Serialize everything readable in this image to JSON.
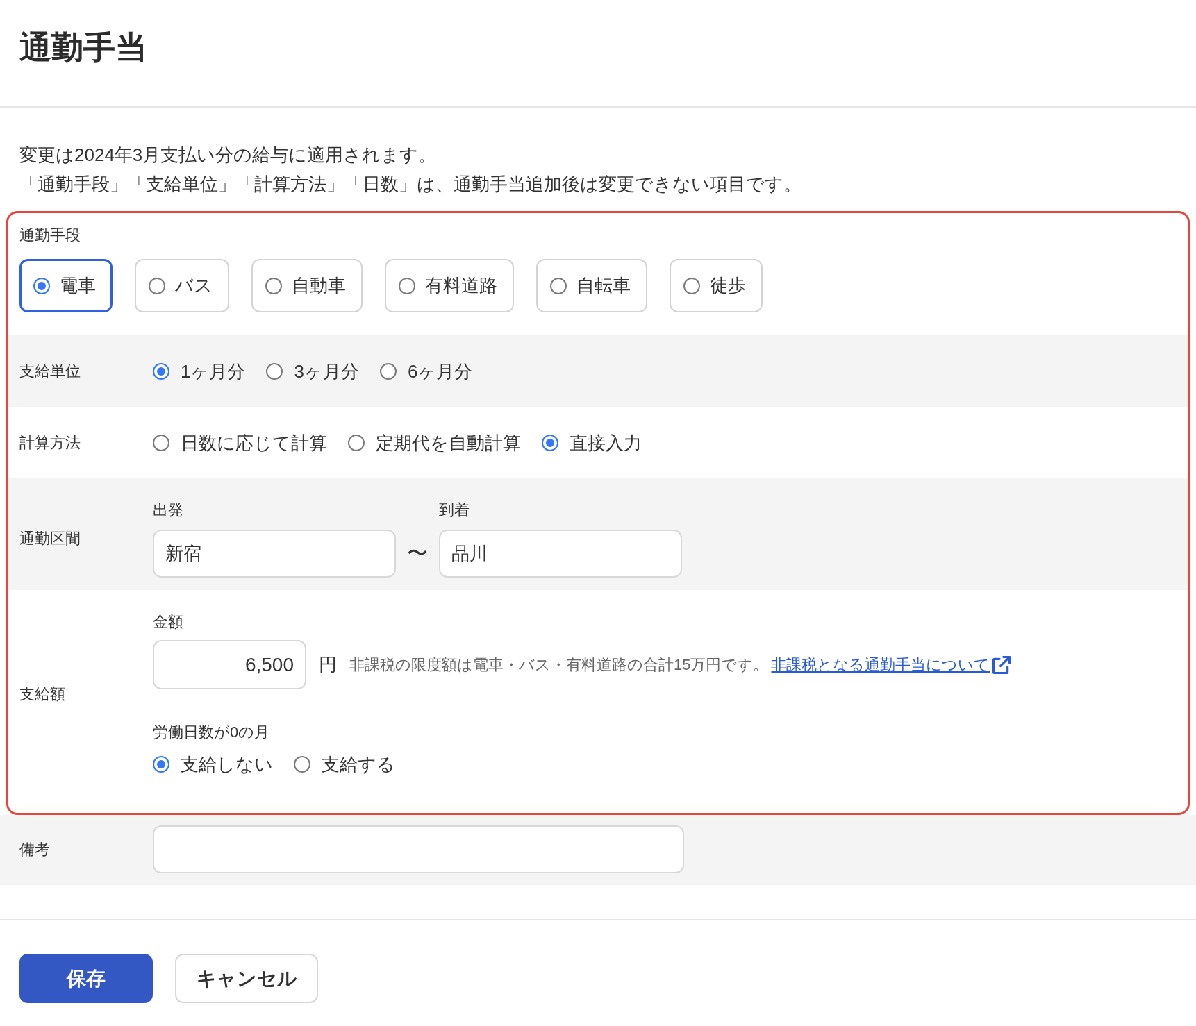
{
  "page": {
    "title": "通勤手当"
  },
  "notice": [
    "変更は2024年3月支払い分の給与に適用されます。",
    "「通勤手段」「支給単位」「計算方法」「日数」は、通勤手当追加後は変更できない項目です。"
  ],
  "highlighted_fields": [
    {
      "kind": "cards",
      "label": "通勤手段",
      "options": [
        {
          "label": "電車",
          "selected": true
        },
        {
          "label": "バス",
          "selected": false
        },
        {
          "label": "自動車",
          "selected": false
        },
        {
          "label": "有料道路",
          "selected": false
        },
        {
          "label": "自転車",
          "selected": false
        },
        {
          "label": "徒歩",
          "selected": false
        }
      ]
    },
    {
      "kind": "radios",
      "label": "支給単位",
      "options": [
        {
          "label": "1ヶ月分",
          "selected": true
        },
        {
          "label": "3ヶ月分",
          "selected": false
        },
        {
          "label": "6ヶ月分",
          "selected": false
        }
      ]
    },
    {
      "kind": "radios",
      "label": "計算方法",
      "options": [
        {
          "label": "日数に応じて計算",
          "selected": false
        },
        {
          "label": "定期代を自動計算",
          "selected": false
        },
        {
          "label": "直接入力",
          "selected": true
        }
      ]
    },
    {
      "kind": "route",
      "label": "通勤区間",
      "departure": {
        "label": "出発",
        "value": "新宿"
      },
      "separator": "〜",
      "arrival": {
        "label": "到着",
        "value": "品川"
      }
    },
    {
      "kind": "amount",
      "label": "支給額",
      "amount": {
        "label": "金額",
        "value": "6,500",
        "unit": "円",
        "note": "非課税の限度額は電車・バス・有料道路の合計15万円です。",
        "link": "非課税となる通勤手当について"
      },
      "zero_days": {
        "label": "労働日数が0の月",
        "options": [
          {
            "label": "支給しない",
            "selected": true
          },
          {
            "label": "支給する",
            "selected": false
          }
        ]
      }
    }
  ],
  "remarks": {
    "label": "備考"
  },
  "buttons": [
    {
      "label": "保存",
      "kind": "primary"
    },
    {
      "label": "キャンセル",
      "kind": "secondary"
    }
  ]
}
